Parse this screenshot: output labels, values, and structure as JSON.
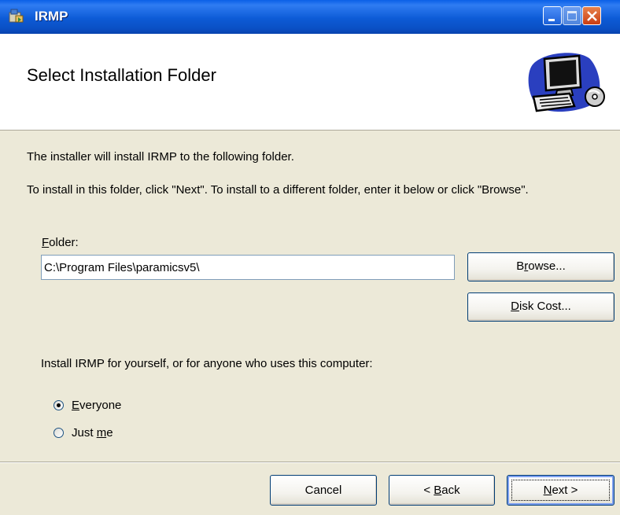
{
  "window": {
    "title": "IRMP",
    "app_icon": "installer-icon"
  },
  "banner": {
    "heading": "Select Installation Folder",
    "image": "computer-icon"
  },
  "intro": {
    "line1": "The installer will install IRMP to the following folder.",
    "line2": "To install in this folder, click \"Next\". To install to a different folder, enter it below or click \"Browse\"."
  },
  "folder": {
    "label_mnemonic": "F",
    "label_rest": "older:",
    "value": "C:\\Program Files\\paramicsv5\\"
  },
  "buttons": {
    "browse_pre": "B",
    "browse_mnemonic": "r",
    "browse_post": "owse...",
    "diskcost_mnemonic": "D",
    "diskcost_post": "isk Cost...",
    "cancel": "Cancel",
    "back_pre": "< ",
    "back_mnemonic": "B",
    "back_post": "ack",
    "next_mnemonic": "N",
    "next_post": "ext >"
  },
  "install_for": {
    "prompt": "Install IRMP for yourself, or for anyone who uses this computer:",
    "options": [
      {
        "pre": "",
        "mnemonic": "E",
        "post": "veryone",
        "checked": true
      },
      {
        "pre": "Just ",
        "mnemonic": "m",
        "post": "e",
        "checked": false
      }
    ]
  },
  "colors": {
    "titlebar": "#0a5fe7",
    "dialog_bg": "#ece9d8",
    "banner_bg": "#ffffff",
    "close_button": "#c93d13"
  }
}
